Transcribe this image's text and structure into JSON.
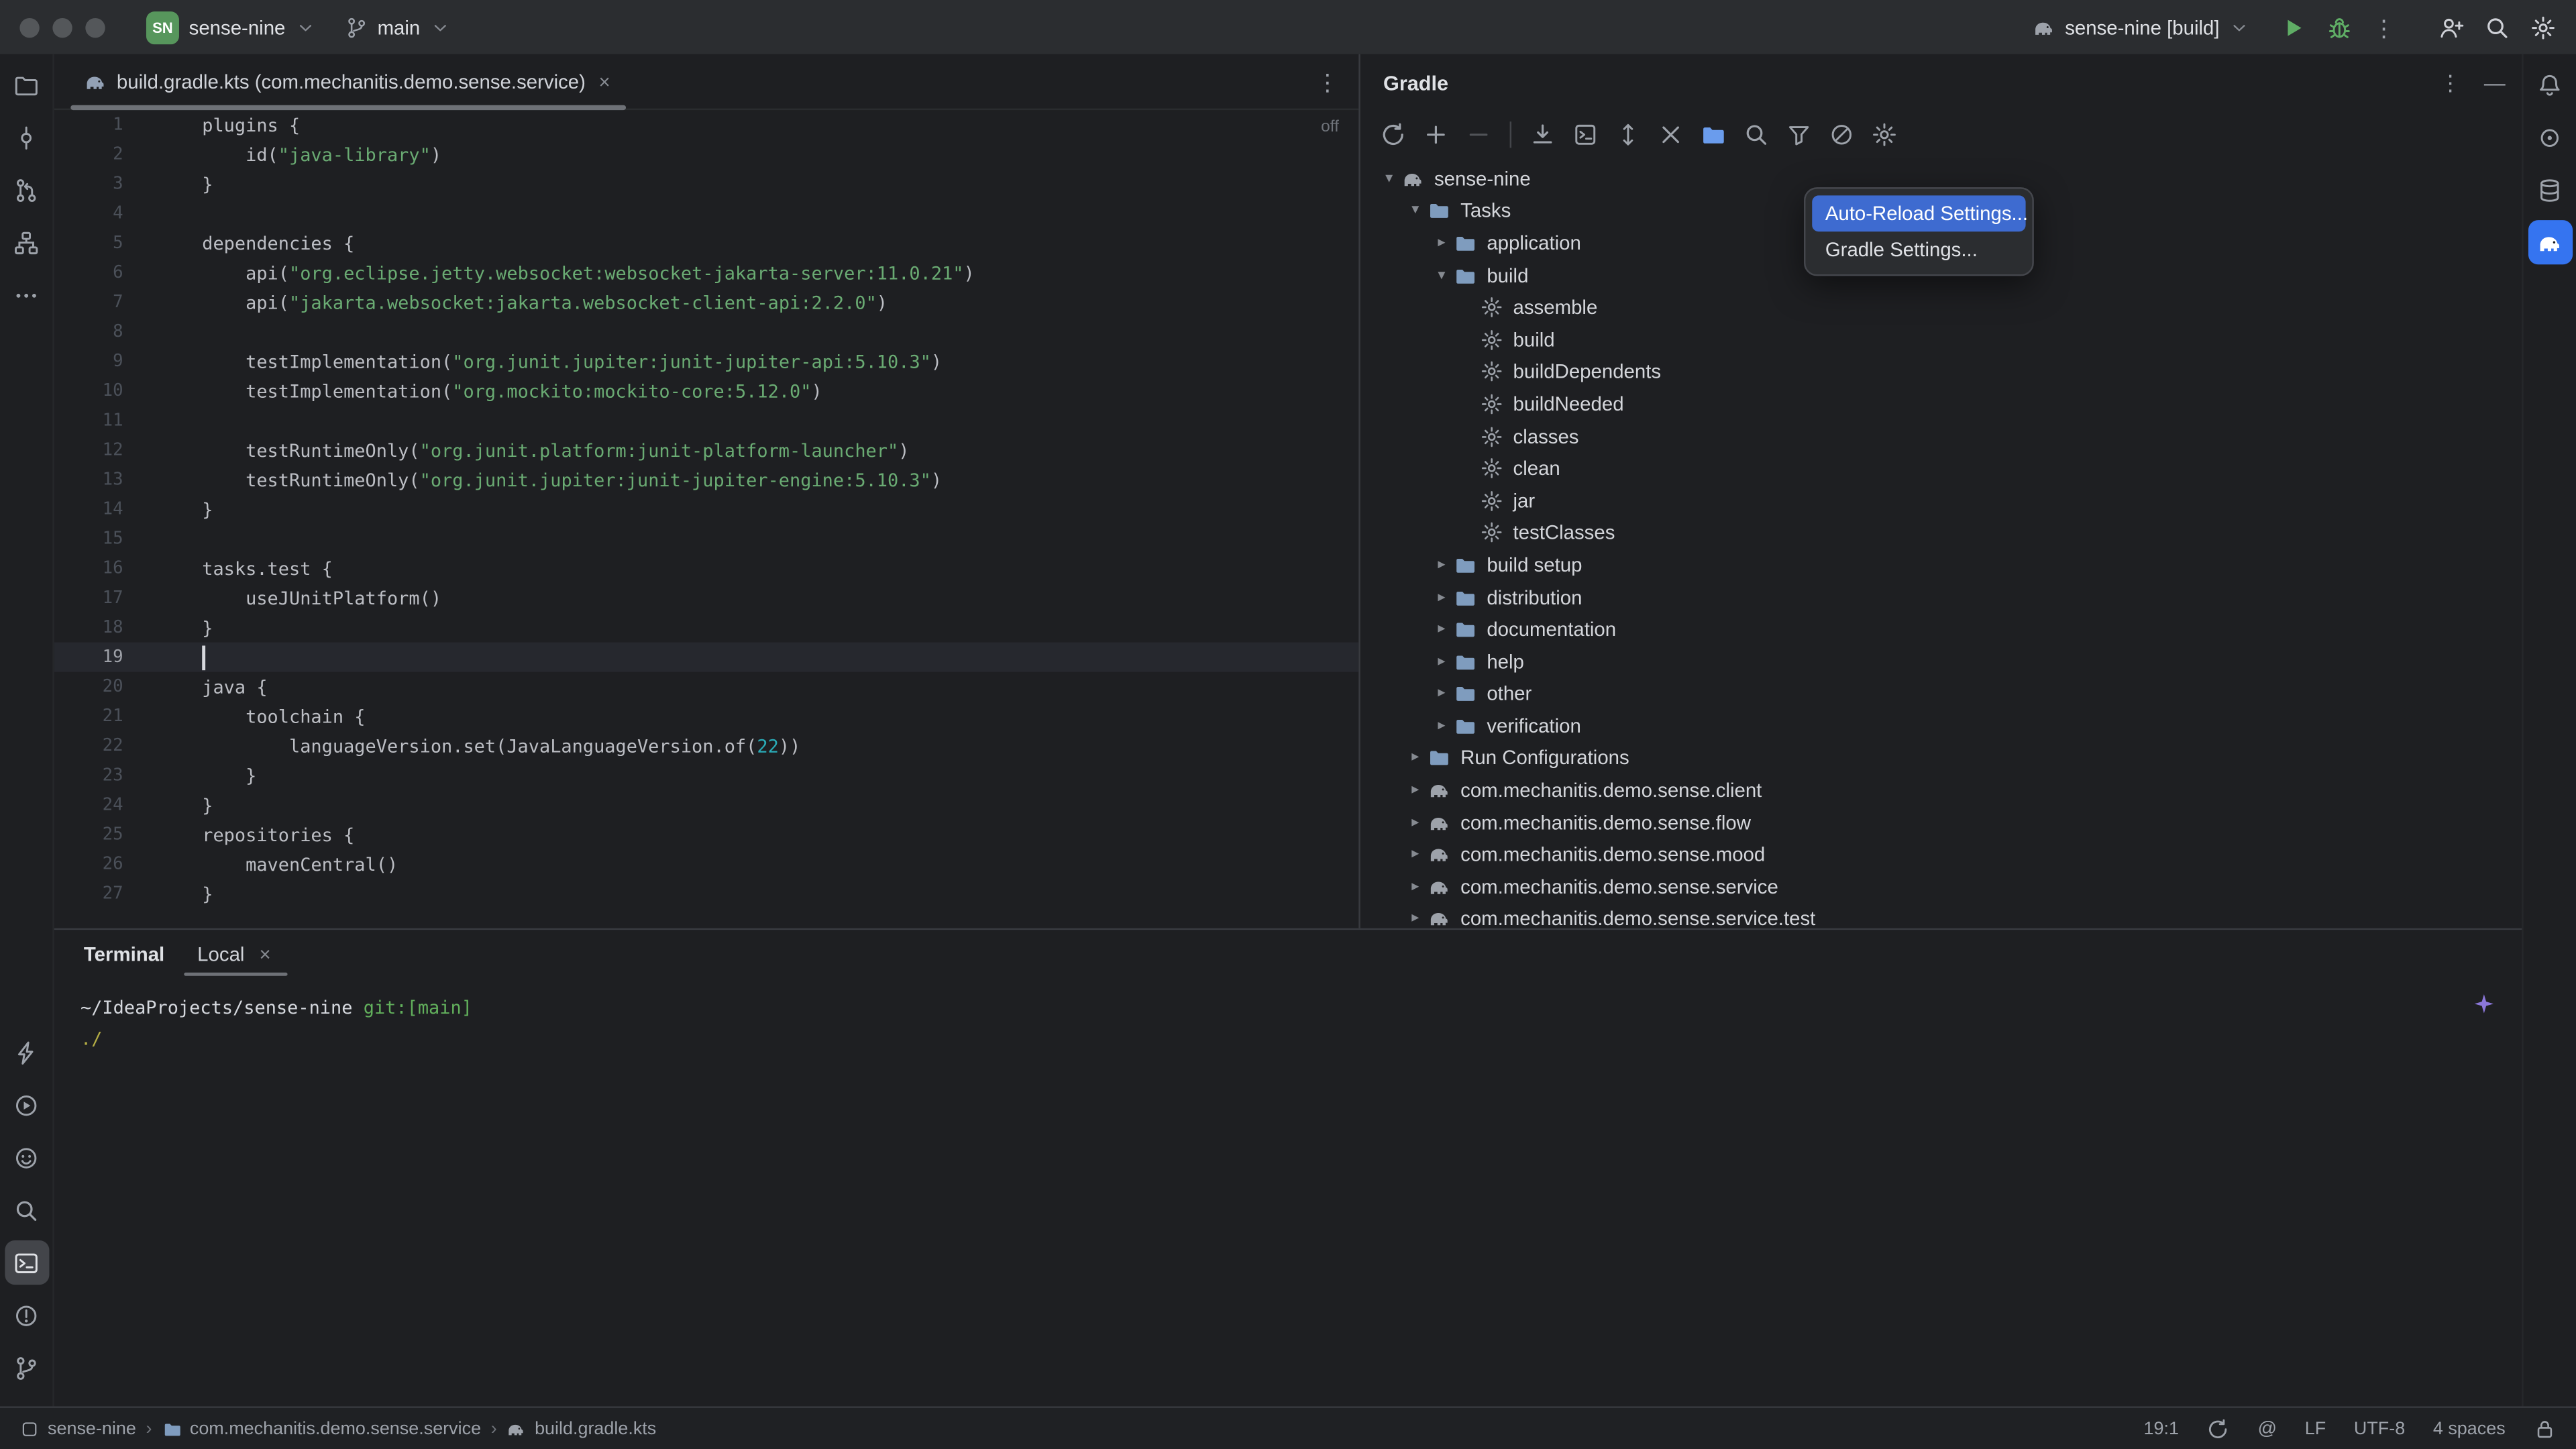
{
  "icons": {
    "close": "×",
    "more_vertical": "⋮",
    "minimize": "—",
    "tree_collapsed": "▸",
    "tree_expanded": "▾",
    "at_sign": "@"
  },
  "colors": {
    "background": "#1e1f22",
    "titlebar": "#2b2d30",
    "popup_selection": "#3e6bd0",
    "string_green": "#6aab73",
    "number_cyan": "#2aacb8",
    "run_green": "#5fad65",
    "active_tool_blue": "#3574f0",
    "project_badge_green": "#57965c"
  },
  "titlebar": {
    "project_badge": "SN",
    "project": "sense-nine",
    "branch": "main",
    "run_config": "sense-nine [build]"
  },
  "editor": {
    "tab": {
      "label": "build.gradle.kts (com.mechanitis.demo.sense.service)"
    },
    "inlay_badge": "off",
    "cursor_line": 19,
    "lines": [
      {
        "s": [
          [
            "d",
            "plugins {"
          ]
        ]
      },
      {
        "s": [
          [
            "d",
            "    id("
          ],
          [
            "s",
            "\"java-library\""
          ],
          [
            "d",
            ")"
          ]
        ]
      },
      {
        "s": [
          [
            "d",
            "}"
          ]
        ]
      },
      {
        "s": []
      },
      {
        "s": [
          [
            "d",
            "dependencies {"
          ]
        ]
      },
      {
        "s": [
          [
            "d",
            "    api("
          ],
          [
            "s",
            "\"org.eclipse.jetty.websocket:websocket-jakarta-server:11.0.21\""
          ],
          [
            "d",
            ")"
          ]
        ]
      },
      {
        "s": [
          [
            "d",
            "    api("
          ],
          [
            "s",
            "\"jakarta.websocket:jakarta.websocket-client-api:2.2.0\""
          ],
          [
            "d",
            ")"
          ]
        ]
      },
      {
        "s": []
      },
      {
        "s": [
          [
            "d",
            "    testImplementation("
          ],
          [
            "s",
            "\"org.junit.jupiter:junit-jupiter-api:5.10.3\""
          ],
          [
            "d",
            ")"
          ]
        ]
      },
      {
        "s": [
          [
            "d",
            "    testImplementation("
          ],
          [
            "s",
            "\"org.mockito:mockito-core:5.12.0\""
          ],
          [
            "d",
            ")"
          ]
        ]
      },
      {
        "s": []
      },
      {
        "s": [
          [
            "d",
            "    testRuntimeOnly("
          ],
          [
            "s",
            "\"org.junit.platform:junit-platform-launcher\""
          ],
          [
            "d",
            ")"
          ]
        ]
      },
      {
        "s": [
          [
            "d",
            "    testRuntimeOnly("
          ],
          [
            "s",
            "\"org.junit.jupiter:junit-jupiter-engine:5.10.3\""
          ],
          [
            "d",
            ")"
          ]
        ]
      },
      {
        "s": [
          [
            "d",
            "}"
          ]
        ]
      },
      {
        "s": []
      },
      {
        "s": [
          [
            "d",
            "tasks.test {"
          ]
        ]
      },
      {
        "s": [
          [
            "d",
            "    useJUnitPlatform()"
          ]
        ]
      },
      {
        "s": [
          [
            "d",
            "}"
          ]
        ]
      },
      {
        "s": []
      },
      {
        "s": [
          [
            "d",
            "java {"
          ]
        ]
      },
      {
        "s": [
          [
            "d",
            "    toolchain {"
          ]
        ]
      },
      {
        "s": [
          [
            "d",
            "        languageVersion.set(JavaLanguageVersion.of("
          ],
          [
            "n",
            "22"
          ],
          [
            "d",
            "))"
          ]
        ]
      },
      {
        "s": [
          [
            "d",
            "    }"
          ]
        ]
      },
      {
        "s": [
          [
            "d",
            "}"
          ]
        ]
      },
      {
        "s": [
          [
            "d",
            "repositories {"
          ]
        ]
      },
      {
        "s": [
          [
            "d",
            "    mavenCentral()"
          ]
        ]
      },
      {
        "s": [
          [
            "d",
            "}"
          ]
        ]
      }
    ]
  },
  "gradle": {
    "title": "Gradle",
    "toolbar": [
      "reload",
      "add",
      "remove",
      "divider",
      "download-sources",
      "execute-task",
      "expand-all",
      "collapse-all",
      "group-tasks",
      "find-task",
      "filter-tasks",
      "offline-mode",
      "settings"
    ],
    "tree": [
      {
        "depth": 0,
        "state": "expanded",
        "icon": "gradle",
        "label": "sense-nine"
      },
      {
        "depth": 1,
        "state": "expanded",
        "icon": "folder",
        "label": "Tasks"
      },
      {
        "depth": 2,
        "state": "collapsed",
        "icon": "folder",
        "label": "application"
      },
      {
        "depth": 2,
        "state": "expanded",
        "icon": "folder",
        "label": "build"
      },
      {
        "depth": 3,
        "state": "leaf",
        "icon": "task",
        "label": "assemble"
      },
      {
        "depth": 3,
        "state": "leaf",
        "icon": "task",
        "label": "build"
      },
      {
        "depth": 3,
        "state": "leaf",
        "icon": "task",
        "label": "buildDependents"
      },
      {
        "depth": 3,
        "state": "leaf",
        "icon": "task",
        "label": "buildNeeded"
      },
      {
        "depth": 3,
        "state": "leaf",
        "icon": "task",
        "label": "classes"
      },
      {
        "depth": 3,
        "state": "leaf",
        "icon": "task",
        "label": "clean"
      },
      {
        "depth": 3,
        "state": "leaf",
        "icon": "task",
        "label": "jar"
      },
      {
        "depth": 3,
        "state": "leaf",
        "icon": "task",
        "label": "testClasses"
      },
      {
        "depth": 2,
        "state": "collapsed",
        "icon": "folder",
        "label": "build setup"
      },
      {
        "depth": 2,
        "state": "collapsed",
        "icon": "folder",
        "label": "distribution"
      },
      {
        "depth": 2,
        "state": "collapsed",
        "icon": "folder",
        "label": "documentation"
      },
      {
        "depth": 2,
        "state": "collapsed",
        "icon": "folder",
        "label": "help"
      },
      {
        "depth": 2,
        "state": "collapsed",
        "icon": "folder",
        "label": "other"
      },
      {
        "depth": 2,
        "state": "collapsed",
        "icon": "folder",
        "label": "verification"
      },
      {
        "depth": 1,
        "state": "collapsed",
        "icon": "folder",
        "label": "Run Configurations"
      },
      {
        "depth": 1,
        "state": "collapsed",
        "icon": "gradle",
        "label": "com.mechanitis.demo.sense.client"
      },
      {
        "depth": 1,
        "state": "collapsed",
        "icon": "gradle",
        "label": "com.mechanitis.demo.sense.flow"
      },
      {
        "depth": 1,
        "state": "collapsed",
        "icon": "gradle",
        "label": "com.mechanitis.demo.sense.mood"
      },
      {
        "depth": 1,
        "state": "collapsed",
        "icon": "gradle",
        "label": "com.mechanitis.demo.sense.service"
      },
      {
        "depth": 1,
        "state": "collapsed",
        "icon": "gradle",
        "label": "com.mechanitis.demo.sense.service.test"
      }
    ],
    "popup": {
      "items": [
        {
          "label": "Auto-Reload Settings...",
          "selected": true
        },
        {
          "label": "Gradle Settings...",
          "selected": false
        }
      ]
    }
  },
  "stripes": {
    "left_top": [
      "project",
      "commit",
      "pull-requests",
      "structure",
      "more"
    ],
    "left_bottom": [
      "build",
      "run",
      "ai-chat",
      "search",
      "terminal",
      "problems",
      "version-control"
    ],
    "left_active": "terminal",
    "right_top": [
      "notifications",
      "ai-assistant",
      "database",
      "gradle"
    ],
    "right_active": "gradle"
  },
  "terminal": {
    "title": "Terminal",
    "tab": "Local",
    "prompt": {
      "path": "~/IdeaProjects/sense-nine",
      "git": "git:[main]"
    },
    "command": "./"
  },
  "statusbar": {
    "breadcrumbs": [
      {
        "icon": "module",
        "label": "sense-nine"
      },
      {
        "icon": "package",
        "label": "com.mechanitis.demo.sense.service"
      },
      {
        "icon": "gradle",
        "label": "build.gradle.kts"
      }
    ],
    "cursor": "19:1",
    "line_ending": "LF",
    "encoding": "UTF-8",
    "indent": "4 spaces"
  }
}
